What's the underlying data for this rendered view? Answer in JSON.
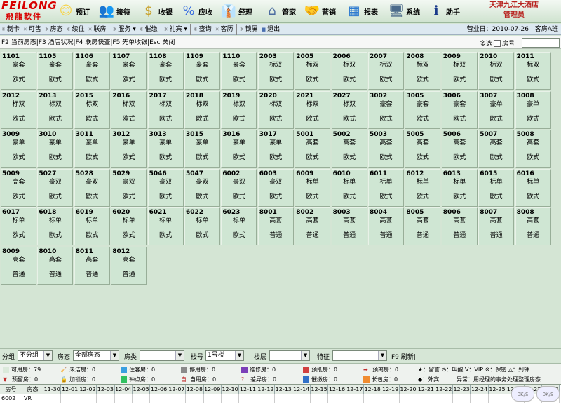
{
  "app": {
    "logo_en": "FEILONG",
    "logo_cn": "飛龍軟件",
    "hotel_name": "天津九江大酒店",
    "user_role": "管理员"
  },
  "toolbar": [
    {
      "label": "预订",
      "icon": "reservation-icon",
      "glyph": "😊"
    },
    {
      "label": "接待",
      "icon": "reception-icon",
      "glyph": "👥"
    },
    {
      "label": "收银",
      "icon": "cashier-icon",
      "glyph": "$"
    },
    {
      "label": "应收",
      "icon": "receivable-icon",
      "glyph": "%"
    },
    {
      "label": "经理",
      "icon": "manager-icon",
      "glyph": "👔"
    },
    {
      "label": "管家",
      "icon": "housekeeping-icon",
      "glyph": "⌂"
    },
    {
      "label": "营销",
      "icon": "marketing-icon",
      "glyph": "🤝"
    },
    {
      "label": "报表",
      "icon": "report-icon",
      "glyph": "▦"
    },
    {
      "label": "系统",
      "icon": "system-icon",
      "glyph": "🖥"
    },
    {
      "label": "助手",
      "icon": "info-icon",
      "glyph": "ℹ"
    }
  ],
  "menu": [
    "制卡",
    "可售",
    "房态",
    "续住",
    "联房",
    "服务 ▾",
    "催缴",
    "礼宾 ▾",
    "查询",
    "客历",
    "锁屏",
    "退出"
  ],
  "business_date": "营业日：2010-07-26",
  "shift": "客房A班",
  "fkeys": "F2 当前房态|F3 酒店状况|F4 联房快查|F5 先单收银|Esc 关闭",
  "multi_select_label": "多选",
  "room_number_label": "房号",
  "rooms": [
    [
      "1101",
      "豪套",
      "欧式"
    ],
    [
      "1105",
      "豪套",
      "欧式"
    ],
    [
      "1106",
      "豪套",
      "欧式"
    ],
    [
      "1107",
      "豪套",
      "欧式"
    ],
    [
      "1108",
      "豪套",
      "欧式"
    ],
    [
      "1109",
      "豪套",
      "欧式"
    ],
    [
      "1110",
      "豪套",
      "欧式"
    ],
    [
      "2003",
      "标双",
      "欧式"
    ],
    [
      "2005",
      "标双",
      "欧式"
    ],
    [
      "2006",
      "标双",
      "欧式"
    ],
    [
      "2007",
      "标双",
      "欧式"
    ],
    [
      "2008",
      "标双",
      "欧式"
    ],
    [
      "2009",
      "标双",
      "欧式"
    ],
    [
      "2010",
      "标双",
      "欧式"
    ],
    [
      "2011",
      "标双",
      "欧式"
    ],
    [
      "2012",
      "标双",
      "欧式"
    ],
    [
      "2013",
      "标双",
      "欧式"
    ],
    [
      "2015",
      "标双",
      "欧式"
    ],
    [
      "2016",
      "标双",
      "欧式"
    ],
    [
      "2017",
      "标双",
      "欧式"
    ],
    [
      "2018",
      "标双",
      "欧式"
    ],
    [
      "2019",
      "标双",
      "欧式"
    ],
    [
      "2020",
      "标双",
      "欧式"
    ],
    [
      "2021",
      "标双",
      "欧式"
    ],
    [
      "2027",
      "标双",
      "欧式"
    ],
    [
      "3002",
      "豪套",
      "欧式"
    ],
    [
      "3005",
      "豪套",
      "欧式"
    ],
    [
      "3006",
      "豪套",
      "欧式"
    ],
    [
      "3007",
      "豪单",
      "欧式"
    ],
    [
      "3008",
      "豪单",
      "欧式"
    ],
    [
      "3009",
      "豪单",
      "欧式"
    ],
    [
      "3010",
      "豪单",
      "欧式"
    ],
    [
      "3011",
      "豪单",
      "欧式"
    ],
    [
      "3012",
      "豪单",
      "欧式"
    ],
    [
      "3013",
      "豪单",
      "欧式"
    ],
    [
      "3015",
      "豪单",
      "欧式"
    ],
    [
      "3016",
      "豪单",
      "欧式"
    ],
    [
      "3017",
      "豪单",
      "欧式"
    ],
    [
      "5001",
      "高套",
      "欧式"
    ],
    [
      "5002",
      "高套",
      "欧式"
    ],
    [
      "5003",
      "高套",
      "欧式"
    ],
    [
      "5005",
      "高套",
      "欧式"
    ],
    [
      "5006",
      "高套",
      "欧式"
    ],
    [
      "5007",
      "高套",
      "欧式"
    ],
    [
      "5008",
      "高套",
      "欧式"
    ],
    [
      "5009",
      "高套",
      "欧式"
    ],
    [
      "5027",
      "豪双",
      "欧式"
    ],
    [
      "5028",
      "豪双",
      "欧式"
    ],
    [
      "5029",
      "豪双",
      "欧式"
    ],
    [
      "5046",
      "豪双",
      "欧式"
    ],
    [
      "5047",
      "豪双",
      "欧式"
    ],
    [
      "6002",
      "豪双",
      "欧式"
    ],
    [
      "6003",
      "豪双",
      "欧式"
    ],
    [
      "6009",
      "标单",
      "欧式"
    ],
    [
      "6010",
      "标单",
      "欧式"
    ],
    [
      "6011",
      "标单",
      "欧式"
    ],
    [
      "6012",
      "标单",
      "欧式"
    ],
    [
      "6013",
      "标单",
      "欧式"
    ],
    [
      "6015",
      "标单",
      "欧式"
    ],
    [
      "6016",
      "标单",
      "欧式"
    ],
    [
      "6017",
      "标单",
      "欧式"
    ],
    [
      "6018",
      "标单",
      "欧式"
    ],
    [
      "6019",
      "标单",
      "欧式"
    ],
    [
      "6020",
      "标单",
      "欧式"
    ],
    [
      "6021",
      "标单",
      "欧式"
    ],
    [
      "6022",
      "标单",
      "欧式"
    ],
    [
      "6023",
      "标单",
      "欧式"
    ],
    [
      "8001",
      "高套",
      "普通"
    ],
    [
      "8002",
      "高套",
      "普通"
    ],
    [
      "8003",
      "高套",
      "普通"
    ],
    [
      "8004",
      "高套",
      "普通"
    ],
    [
      "8005",
      "高套",
      "普通"
    ],
    [
      "8006",
      "高套",
      "普通"
    ],
    [
      "8007",
      "高套",
      "普通"
    ],
    [
      "8008",
      "高套",
      "普通"
    ],
    [
      "8009",
      "高套",
      "普通"
    ],
    [
      "8010",
      "高套",
      "普通"
    ],
    [
      "8011",
      "高套",
      "普通"
    ],
    [
      "8012",
      "高套",
      "普通"
    ]
  ],
  "filters": {
    "group_label": "分组",
    "group_value": "不分组",
    "status_label": "房态",
    "status_value": "全部房态",
    "type_label": "房类",
    "type_value": "",
    "building_label": "楼号",
    "building_value": "1号楼",
    "floor_label": "楼层",
    "floor_value": "",
    "feature_label": "特征",
    "feature_value": "",
    "refresh": "F9 刷新|"
  },
  "legend": [
    {
      "label": "可用房：79",
      "color": "#dbe9db",
      "glyph": ""
    },
    {
      "label": "未洁房：0",
      "color": "",
      "glyph": "🧹"
    },
    {
      "label": "住客房：0",
      "color": "#3aa0e0",
      "glyph": ""
    },
    {
      "label": "停用房：0",
      "color": "#8a8a8a",
      "glyph": ""
    },
    {
      "label": "维修房：0",
      "color": "#7b3fb8",
      "glyph": ""
    },
    {
      "label": "预抵房：0",
      "color": "#d04040",
      "glyph": ""
    },
    {
      "label": "预离房：0",
      "color": "",
      "glyph": "➡"
    },
    {
      "label": "预留房：0",
      "color": "",
      "glyph": "▼"
    },
    {
      "label": "加锁房：0",
      "color": "",
      "glyph": "🔒"
    },
    {
      "label": "钟点房：0",
      "color": "#30c060",
      "glyph": ""
    },
    {
      "label": "自用房：0",
      "color": "",
      "glyph": "自"
    },
    {
      "label": "差异房：0",
      "color": "",
      "glyph": "?"
    },
    {
      "label": "催缴房：0",
      "color": "#3070c8",
      "glyph": ""
    },
    {
      "label": "长包房：0",
      "color": "#f08c30",
      "glyph": ""
    }
  ],
  "legend_notes": {
    "line1": "★：留言 ⊙：叫醒 V：VIP ※：保密 △：到钟",
    "line2": "◆：外宾",
    "line3": "异常：用经理的事务处理整理房态"
  },
  "date_strip": {
    "headers": [
      "房号",
      "房态",
      "11-30",
      "12-01",
      "12-02",
      "12-03",
      "12-04",
      "12-05",
      "12-06",
      "12-07",
      "12-08",
      "12-09",
      "12-10",
      "12-11",
      "12-12",
      "12-13",
      "12-14",
      "12-15",
      "12-16",
      "12-17",
      "12-18",
      "12-19",
      "12-20",
      "12-21",
      "12-22",
      "12-23",
      "12-24",
      "12-25",
      "12-26",
      "12-27",
      "12-28"
    ],
    "row": [
      "6002",
      "VR"
    ],
    "speed1": "0K/S",
    "speed2": "0K/S"
  }
}
